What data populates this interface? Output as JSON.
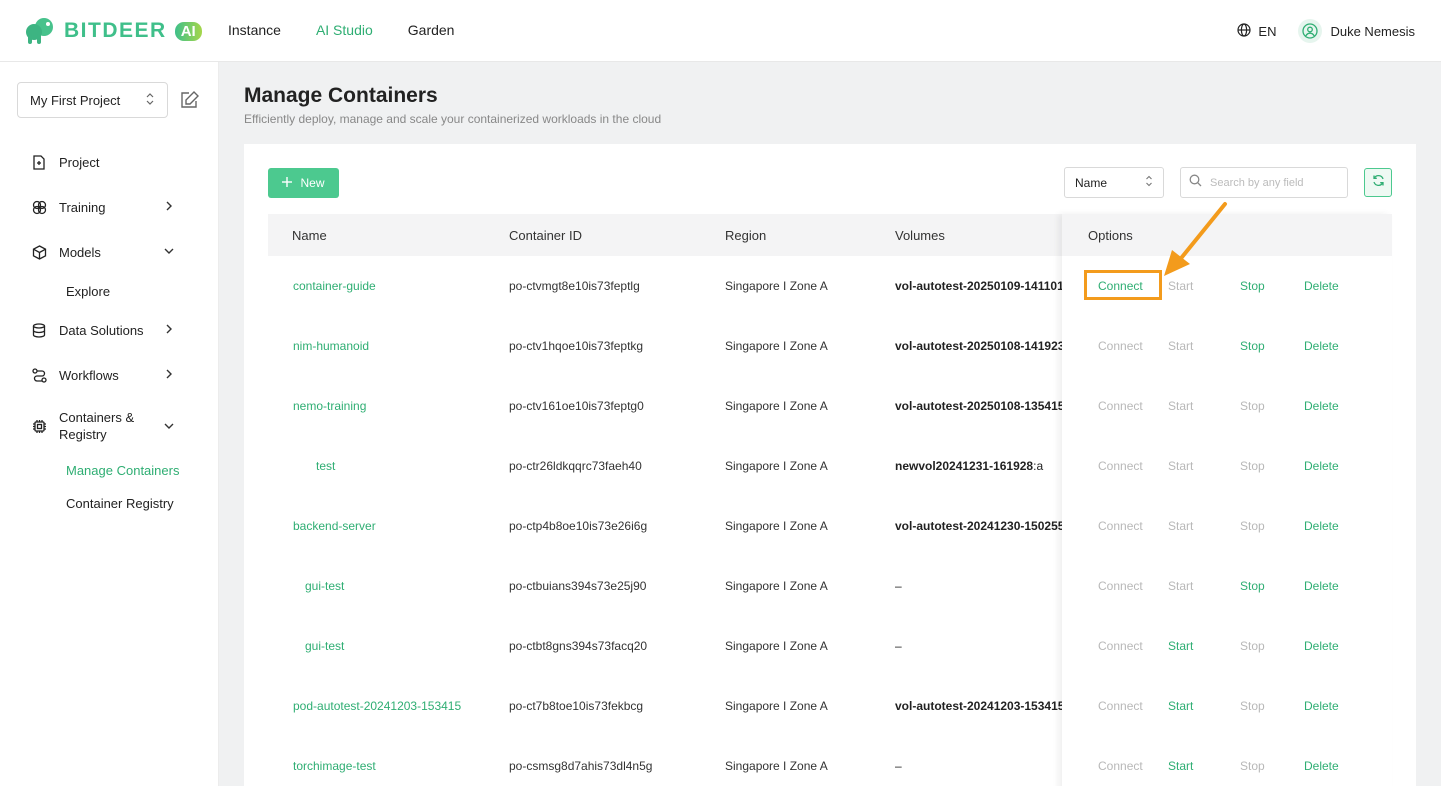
{
  "header": {
    "logo_text": "BITDEER",
    "logo_badge": "AI",
    "nav": [
      {
        "label": "Instance"
      },
      {
        "label": "AI Studio"
      },
      {
        "label": "Garden"
      }
    ],
    "language": "EN",
    "user_name": "Duke Nemesis"
  },
  "sidebar": {
    "project_select": "My First Project",
    "items": [
      {
        "label": "Project"
      },
      {
        "label": "Training"
      },
      {
        "label": "Models"
      },
      {
        "label": "Explore"
      },
      {
        "label": "Data Solutions"
      },
      {
        "label": "Workflows"
      },
      {
        "label": "Containers &\nRegistry"
      },
      {
        "label": "Manage Containers"
      },
      {
        "label": "Container Registry"
      }
    ]
  },
  "page": {
    "title": "Manage Containers",
    "subtitle": "Efficiently deploy, manage and scale your containerized workloads in the cloud"
  },
  "toolbar": {
    "new_label": "New",
    "filter_value": "Name",
    "search_placeholder": "Search by any field"
  },
  "table": {
    "columns": [
      "Name",
      "Container ID",
      "Region",
      "Volumes",
      "Options"
    ],
    "rows": [
      {
        "name": "container-guide",
        "id": "po-ctvmgt8e10is73feptlg",
        "region": "Singapore I Zone A",
        "volume": "vol-autotest-20250109-141101",
        "volume_tail": ""
      },
      {
        "name": "nim-humanoid",
        "id": "po-ctv1hqoe10is73feptkg",
        "region": "Singapore I Zone A",
        "volume": "vol-autotest-20250108-141923",
        "volume_tail": ""
      },
      {
        "name": "nemo-training",
        "id": "po-ctv161oe10is73feptg0",
        "region": "Singapore I Zone A",
        "volume": "vol-autotest-20250108-135415",
        "volume_tail": ""
      },
      {
        "name": "test",
        "id": "po-ctr26ldkqqrc73faeh40",
        "region": "Singapore I Zone A",
        "volume": "newvol20241231-161928",
        "volume_tail": ":a"
      },
      {
        "name": "backend-server",
        "id": "po-ctp4b8oe10is73e26i6g",
        "region": "Singapore I Zone A",
        "volume": "vol-autotest-20241230-150255",
        "volume_tail": ""
      },
      {
        "name": "gui-test",
        "id": "po-ctbuians394s73e25j90",
        "region": "Singapore I Zone A",
        "volume": "",
        "volume_tail": "–"
      },
      {
        "name": "gui-test",
        "id": "po-ctbt8gns394s73facq20",
        "region": "Singapore I Zone A",
        "volume": "",
        "volume_tail": "–"
      },
      {
        "name": "pod-autotest-20241203-153415",
        "id": "po-ct7b8toe10is73fekbcg",
        "region": "Singapore I Zone A",
        "volume": "vol-autotest-20241203-153415",
        "volume_tail": ""
      },
      {
        "name": "torchimage-test",
        "id": "po-csmsg8d7ahis73dl4n5g",
        "region": "Singapore I Zone A",
        "volume": "",
        "volume_tail": "–"
      }
    ],
    "options_labels": {
      "connect": "Connect",
      "start": "Start",
      "stop": "Stop",
      "delete": "Delete"
    },
    "options_state": [
      {
        "connect": true,
        "start": false,
        "stop": true,
        "delete": true
      },
      {
        "connect": false,
        "start": false,
        "stop": true,
        "delete": true
      },
      {
        "connect": false,
        "start": false,
        "stop": false,
        "delete": true
      },
      {
        "connect": false,
        "start": false,
        "stop": false,
        "delete": true
      },
      {
        "connect": false,
        "start": false,
        "stop": false,
        "delete": true
      },
      {
        "connect": false,
        "start": false,
        "stop": true,
        "delete": true
      },
      {
        "connect": false,
        "start": true,
        "stop": false,
        "delete": true
      },
      {
        "connect": false,
        "start": true,
        "stop": false,
        "delete": true
      },
      {
        "connect": false,
        "start": true,
        "stop": false,
        "delete": true
      }
    ]
  },
  "colors": {
    "accent": "#2fae73",
    "button": "#4cc98f",
    "disabled": "#b8b8b8",
    "highlight": "#f39b1c"
  }
}
